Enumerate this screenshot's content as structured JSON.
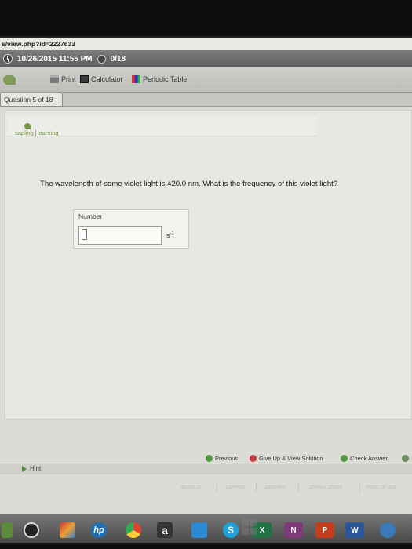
{
  "url": "s/view.php?id=2227633",
  "timebar": {
    "datetime": "10/26/2015 11:55 PM",
    "score": "0/18"
  },
  "toolbar": {
    "print": "Print",
    "calculator": "Calculator",
    "periodic_table": "Periodic Table"
  },
  "question_tab": "Question 5 of 18",
  "brand": {
    "left": "sapling",
    "right": "learning"
  },
  "question": {
    "text": "The wavelength of some violet light is 420.0 nm. What is the frequency of this violet light?",
    "answer_label": "Number",
    "answer_value": "",
    "unit_base": "s",
    "unit_exp": "-1"
  },
  "nav": {
    "previous": "Previous",
    "give_up": "Give Up & View Solution",
    "check_answer": "Check Answer"
  },
  "hint": "Hint",
  "footer": [
    "about us",
    "careers",
    "partners",
    "privacy policy",
    "terms of use"
  ],
  "taskbar": {
    "icons": [
      "apps-icon",
      "media-icon",
      "photos-icon",
      "hp-icon",
      "chrome-icon",
      "amazon-icon",
      "weather-icon",
      "skype-icon",
      "excel-icon",
      "onenote-icon",
      "powerpoint-icon",
      "word-icon",
      "store-icon"
    ],
    "letters": [
      "hp",
      "a",
      "S",
      "X",
      "N",
      "P",
      "W"
    ]
  },
  "colors": {
    "accent_green": "#4f9b3f",
    "sapling_green": "#7a9a47",
    "give_up_red": "#c54040"
  }
}
